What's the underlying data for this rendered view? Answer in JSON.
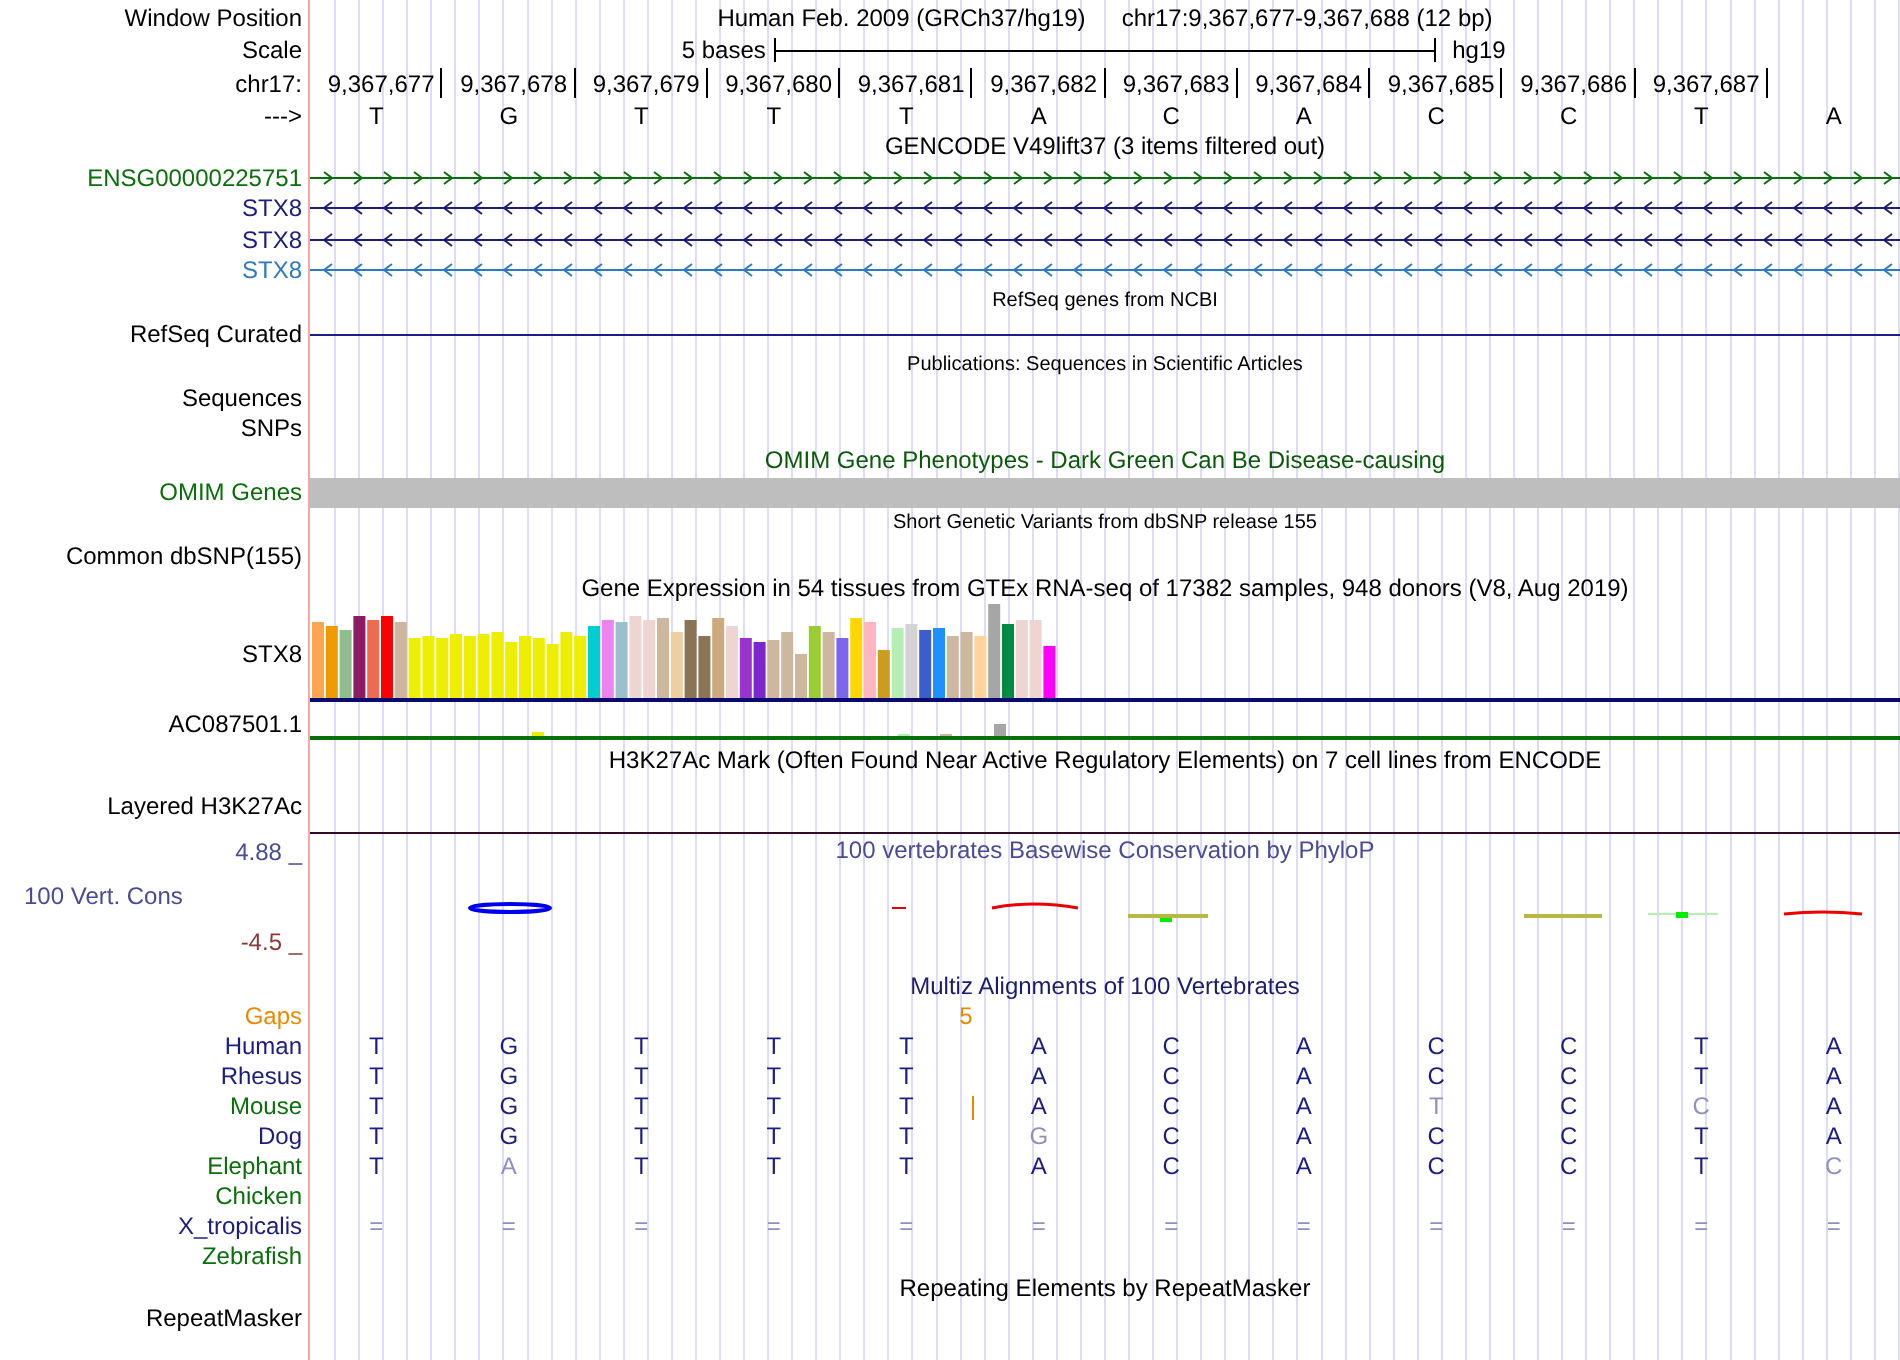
{
  "header": {
    "label": "Window Position",
    "title": "Human Feb. 2009 (GRCh37/hg19)",
    "position": "chr17:9,367,677-9,367,688 (12 bp)"
  },
  "scale": {
    "label": "Scale",
    "length": "5 bases",
    "assembly": "hg19"
  },
  "ruler": {
    "label": "chr17:",
    "positions": [
      "9,367,677",
      "9,367,678",
      "9,367,679",
      "9,367,680",
      "9,367,681",
      "9,367,682",
      "9,367,683",
      "9,367,684",
      "9,367,685",
      "9,367,686",
      "9,367,687"
    ]
  },
  "sequence": {
    "label": "--->",
    "bases": [
      "T",
      "G",
      "T",
      "T",
      "T",
      "A",
      "C",
      "A",
      "C",
      "C",
      "T",
      "A"
    ]
  },
  "tracks": [
    {
      "kind": "title",
      "text": "GENCODE V49lift37 (3 items filtered out)",
      "color": "#000000",
      "small": false
    },
    {
      "kind": "gene",
      "label": "ENSG00000225751",
      "color": "#0a6e0a",
      "reverse": false
    },
    {
      "kind": "gene",
      "label": "STX8",
      "color": "#1c1c82",
      "reverse": true
    },
    {
      "kind": "gene",
      "label": "STX8",
      "color": "#1c1c82",
      "reverse": true
    },
    {
      "kind": "gene",
      "label": "STX8",
      "color": "#2b7bc4",
      "reverse": true
    },
    {
      "kind": "title",
      "text": "RefSeq genes from NCBI",
      "color": "#000000",
      "small": true
    },
    {
      "kind": "line",
      "label": "RefSeq Curated",
      "color": "#1c1c82",
      "line_at_bottom": false
    },
    {
      "kind": "title",
      "text": "Publications: Sequences in Scientific Articles",
      "color": "#000000",
      "small": true
    },
    {
      "kind": "label",
      "label": "Sequences"
    },
    {
      "kind": "label",
      "label": "SNPs"
    },
    {
      "kind": "title",
      "text": "OMIM Gene Phenotypes - Dark Green Can Be Disease-causing",
      "color": "#0a5a0a",
      "small": false
    },
    {
      "kind": "omim",
      "label": "OMIM Genes",
      "color": "#0a6e0a"
    },
    {
      "kind": "title",
      "text": "Short Genetic Variants from dbSNP release 155",
      "color": "#000000",
      "small": true
    },
    {
      "kind": "label",
      "label": "Common dbSNP(155)"
    },
    {
      "kind": "title",
      "text": "Gene Expression in 54 tissues from GTEx RNA-seq of 17382 samples, 948 donors (V8, Aug 2019)",
      "color": "#000000",
      "small": false
    },
    {
      "kind": "expression",
      "label": "STX8",
      "color": "#0a0a6e"
    },
    {
      "kind": "minibars",
      "label": "AC087501.1",
      "color": "#0a6e0a"
    },
    {
      "kind": "title",
      "text": "H3K27Ac Mark (Often Found Near Active Regulatory Elements) on 7 cell lines from ENCODE",
      "color": "#000000",
      "small": false
    },
    {
      "kind": "line",
      "label": "Layered H3K27Ac",
      "color": "#330a2a",
      "line_at_bottom": true
    },
    {
      "kind": "cons",
      "label": "100 Vert. Cons",
      "color": "#4a4a99",
      "title": "100 vertebrates Basewise Conservation by PhyloP",
      "top": "4.88 _",
      "bottom": "-4.5 _"
    },
    {
      "kind": "title",
      "text": "Multiz Alignments of 100 Vertebrates",
      "color": "#1c1c6e",
      "small": false
    },
    {
      "kind": "gaps",
      "label": "Gaps",
      "color": "#e88a00",
      "text": "5"
    },
    {
      "kind": "species",
      "label": "Human",
      "color": "#1c1c82",
      "gap": false,
      "bases": [
        {
          "text": "T",
          "faded": false
        },
        {
          "text": "G",
          "faded": false
        },
        {
          "text": "T",
          "faded": false
        },
        {
          "text": "T",
          "faded": false
        },
        {
          "text": "T",
          "faded": false
        },
        {
          "text": "A",
          "faded": false
        },
        {
          "text": "C",
          "faded": false
        },
        {
          "text": "A",
          "faded": false
        },
        {
          "text": "C",
          "faded": false
        },
        {
          "text": "C",
          "faded": false
        },
        {
          "text": "T",
          "faded": false
        },
        {
          "text": "A",
          "faded": false
        }
      ]
    },
    {
      "kind": "species",
      "label": "Rhesus",
      "color": "#1c1c82",
      "gap": false,
      "bases": [
        {
          "text": "T",
          "faded": false
        },
        {
          "text": "G",
          "faded": false
        },
        {
          "text": "T",
          "faded": false
        },
        {
          "text": "T",
          "faded": false
        },
        {
          "text": "T",
          "faded": false
        },
        {
          "text": "A",
          "faded": false
        },
        {
          "text": "C",
          "faded": false
        },
        {
          "text": "A",
          "faded": false
        },
        {
          "text": "C",
          "faded": false
        },
        {
          "text": "C",
          "faded": false
        },
        {
          "text": "T",
          "faded": false
        },
        {
          "text": "A",
          "faded": false
        }
      ]
    },
    {
      "kind": "species",
      "label": "Mouse",
      "color": "#0a6e0a",
      "gap": true,
      "bases": [
        {
          "text": "T",
          "faded": false
        },
        {
          "text": "G",
          "faded": false
        },
        {
          "text": "T",
          "faded": false
        },
        {
          "text": "T",
          "faded": false
        },
        {
          "text": "T",
          "faded": false
        },
        {
          "text": "A",
          "faded": false
        },
        {
          "text": "C",
          "faded": false
        },
        {
          "text": "A",
          "faded": false
        },
        {
          "text": "T",
          "faded": true
        },
        {
          "text": "C",
          "faded": false
        },
        {
          "text": "C",
          "faded": true
        },
        {
          "text": "A",
          "faded": false
        }
      ]
    },
    {
      "kind": "species",
      "label": "Dog",
      "color": "#1c1c82",
      "gap": false,
      "bases": [
        {
          "text": "T",
          "faded": false
        },
        {
          "text": "G",
          "faded": false
        },
        {
          "text": "T",
          "faded": false
        },
        {
          "text": "T",
          "faded": false
        },
        {
          "text": "T",
          "faded": false
        },
        {
          "text": "G",
          "faded": true
        },
        {
          "text": "C",
          "faded": false
        },
        {
          "text": "A",
          "faded": false
        },
        {
          "text": "C",
          "faded": false
        },
        {
          "text": "C",
          "faded": false
        },
        {
          "text": "T",
          "faded": false
        },
        {
          "text": "A",
          "faded": false
        }
      ]
    },
    {
      "kind": "species",
      "label": "Elephant",
      "color": "#0a6e0a",
      "gap": false,
      "bases": [
        {
          "text": "T",
          "faded": false
        },
        {
          "text": "A",
          "faded": true
        },
        {
          "text": "T",
          "faded": false
        },
        {
          "text": "T",
          "faded": false
        },
        {
          "text": "T",
          "faded": false
        },
        {
          "text": "A",
          "faded": false
        },
        {
          "text": "C",
          "faded": false
        },
        {
          "text": "A",
          "faded": false
        },
        {
          "text": "C",
          "faded": false
        },
        {
          "text": "C",
          "faded": false
        },
        {
          "text": "T",
          "faded": false
        },
        {
          "text": "C",
          "faded": true
        }
      ]
    },
    {
      "kind": "species",
      "label": "Chicken",
      "color": "#0a6e0a",
      "gap": false
    },
    {
      "kind": "species",
      "label": "X_tropicalis",
      "color": "#1c1c82",
      "gap": false,
      "bases": [
        {
          "text": "=",
          "faded": true
        },
        {
          "text": "=",
          "faded": true
        },
        {
          "text": "=",
          "faded": true
        },
        {
          "text": "=",
          "faded": true
        },
        {
          "text": "=",
          "faded": true
        },
        {
          "text": "=",
          "faded": true
        },
        {
          "text": "=",
          "faded": true
        },
        {
          "text": "=",
          "faded": true
        },
        {
          "text": "=",
          "faded": true
        },
        {
          "text": "=",
          "faded": true
        },
        {
          "text": "=",
          "faded": true
        },
        {
          "text": "=",
          "faded": true
        }
      ]
    },
    {
      "kind": "species",
      "label": "Zebrafish",
      "color": "#0a6e0a",
      "gap": false
    },
    {
      "kind": "title",
      "text": "Repeating Elements by RepeatMasker",
      "color": "#000000",
      "small": false
    },
    {
      "kind": "label",
      "label": "RepeatMasker"
    }
  ]
}
